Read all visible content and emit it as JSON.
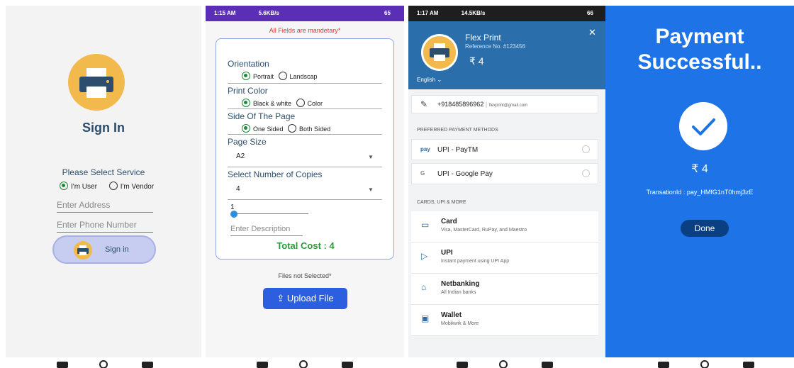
{
  "signin": {
    "title": "Sign In",
    "select_label": "Please Select Service",
    "role_user": "I'm User",
    "role_vendor": "I'm Vendor",
    "address_placeholder": "Enter Address",
    "phone_placeholder": "Enter Phone Number",
    "button_label": "Sign in"
  },
  "order": {
    "status_time": "1:15 AM",
    "status_net": "5.6KB/s",
    "status_battery": "65",
    "warning": "All Fields are mandetary*",
    "orientation_label": "Orientation",
    "orientation_opt1": "Portrait",
    "orientation_opt2": "Landscap",
    "color_label": "Print Color",
    "color_opt1": "Black & white",
    "color_opt2": "Color",
    "side_label": "Side Of The Page",
    "side_opt1": "One Sided",
    "side_opt2": "Both Sided",
    "size_label": "Page Size",
    "size_value": "A2",
    "copies_label": "Select Number of Copies",
    "copies_value": "4",
    "quantity_value": "1",
    "description_placeholder": "Enter Description",
    "total": "Total Cost : 4",
    "files_status": "Files not Selected*",
    "upload_label": "Upload File"
  },
  "checkout": {
    "status_time": "1:17 AM",
    "status_net": "14.5KB/s",
    "status_battery": "66",
    "merchant": "Flex Print",
    "reference": "Reference No. #123456",
    "amount": "₹ 4",
    "language": "English",
    "phone": "+918485896962",
    "email": "flexprint@gmail.com",
    "preferred_heading": "PREFERRED PAYMENT METHODS",
    "preferred": [
      {
        "name": "UPI - PayTM",
        "icon": "paytm"
      },
      {
        "name": "UPI - Google Pay",
        "icon": "gpay"
      }
    ],
    "more_heading": "CARDS, UPI & MORE",
    "methods": [
      {
        "title": "Card",
        "sub": "Visa, MasterCard, RuPay, and Maestro"
      },
      {
        "title": "UPI",
        "sub": "Instant payment using UPI App"
      },
      {
        "title": "Netbanking",
        "sub": "All Indian banks"
      },
      {
        "title": "Wallet",
        "sub": "Mobikwik & More"
      }
    ]
  },
  "success": {
    "heading": "Payment Successful..",
    "amount": "₹ 4",
    "transaction": "TransationId : pay_HMfG1nT0hmj3zE",
    "done_label": "Done"
  },
  "colors": {
    "brand_blue": "#1e73e6",
    "checkout_header": "#2a6fab",
    "success_green": "#2b9a3a",
    "accent_yellow": "#f2b94d",
    "status_purple": "#5b2fb5"
  }
}
